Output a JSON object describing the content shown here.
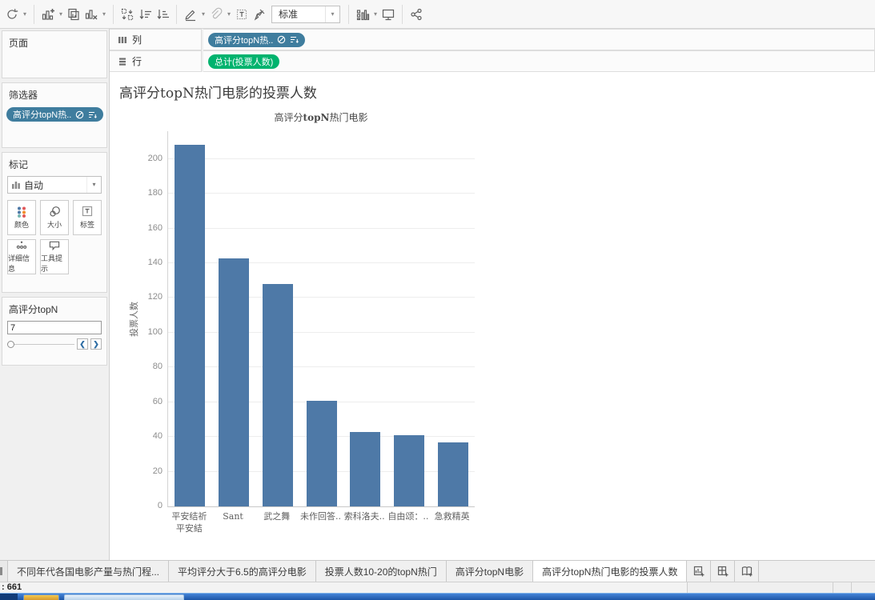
{
  "toolbar": {
    "fit_mode": "标准"
  },
  "sidebar": {
    "pages_title": "页面",
    "filters_title": "筛选器",
    "filter_pill": "高评分topN热..",
    "marks_title": "标记",
    "mark_type": "自动",
    "marks_buttons": [
      {
        "label": "颜色"
      },
      {
        "label": "大小"
      },
      {
        "label": "标签"
      },
      {
        "label": "详细信息"
      },
      {
        "label": "工具提示"
      }
    ],
    "parameter": {
      "title": "高评分topN",
      "value": "7"
    }
  },
  "shelves": {
    "columns_label": "列",
    "rows_label": "行",
    "columns_pill": "高评分topN热..",
    "rows_pill": "总计(投票人数)"
  },
  "sheet_title": "高评分topN热门电影的投票人数",
  "chart_data": {
    "type": "bar",
    "title": "高评分topN热门电影",
    "title_parts": {
      "prefix": "高评分",
      "bold": "topN",
      "suffix": "热门电影"
    },
    "categories": [
      "平安结祈\n平安結",
      "Sant",
      "武之舞",
      "未作回答..",
      "索科洛夫..",
      "自由颂：..",
      "急救精英"
    ],
    "values": [
      208,
      143,
      128,
      61,
      43,
      41,
      37
    ],
    "xlabel": "",
    "ylabel": "投票人数",
    "ylim": [
      0,
      216
    ],
    "yticks": [
      0,
      20,
      40,
      60,
      80,
      100,
      120,
      140,
      160,
      180,
      200
    ],
    "bar_color": "#4e79a7",
    "grid": true,
    "legend_position": "none"
  },
  "tabs": {
    "items": [
      {
        "label": "不同年代各国电影产量与热门程..."
      },
      {
        "label": "平均评分大于6.5的高评分电影"
      },
      {
        "label": "投票人数10-20的topN热门"
      },
      {
        "label": "高评分topN电影"
      },
      {
        "label": "高评分topN热门电影的投票人数"
      }
    ],
    "active_index": 4
  },
  "status_bar": {
    "left": ": 661"
  },
  "colors": {
    "dimension_pill": "#3f7d9e",
    "measure_pill": "#00b36e",
    "bar": "#4e79a7"
  }
}
